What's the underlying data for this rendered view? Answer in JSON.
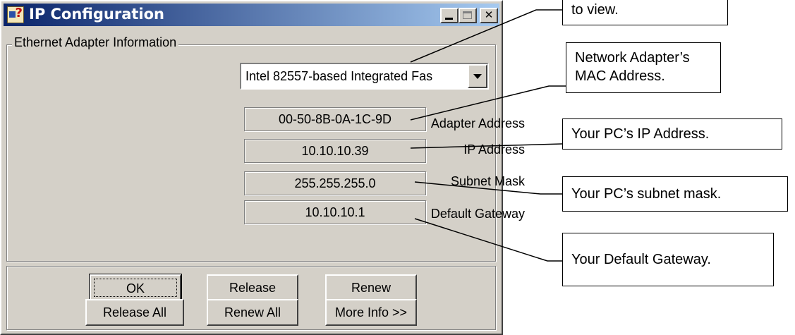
{
  "window": {
    "title": "IP Configuration",
    "title_bar_buttons": [
      "minimize",
      "maximize",
      "close"
    ],
    "close_glyph": "✕"
  },
  "group_label": "Ethernet  Adapter Information",
  "adapter_select": {
    "value": "Intel 82557-based Integrated Fas"
  },
  "fields": {
    "adapter_address": {
      "label": "Adapter Address",
      "value": "00-50-8B-0A-1C-9D"
    },
    "ip_address": {
      "label": "IP Address",
      "value": "10.10.10.39"
    },
    "subnet_mask": {
      "label": "Subnet Mask",
      "value": "255.255.255.0"
    },
    "default_gateway": {
      "label": "Default Gateway",
      "value": "10.10.10.1"
    }
  },
  "buttons": {
    "ok": "OK",
    "release": "Release",
    "renew": "Renew",
    "release_all": "Release All",
    "renew_all": "Renew All",
    "more_info": "More Info >>"
  },
  "callouts": {
    "top": "to view.",
    "mac": "Network Adapter’s MAC Address.",
    "ip": "Your PC’s IP Address.",
    "subnet": "Your PC’s subnet mask.",
    "gateway": "Your Default Gateway."
  },
  "colors": {
    "title_bar_start": "#0a246a",
    "title_bar_end": "#a6caf0",
    "dialog_face": "#d4d0c8"
  },
  "icons": [
    "ip-config-app-icon",
    "minimize-icon",
    "maximize-icon",
    "close-icon",
    "dropdown-arrow-icon"
  ]
}
